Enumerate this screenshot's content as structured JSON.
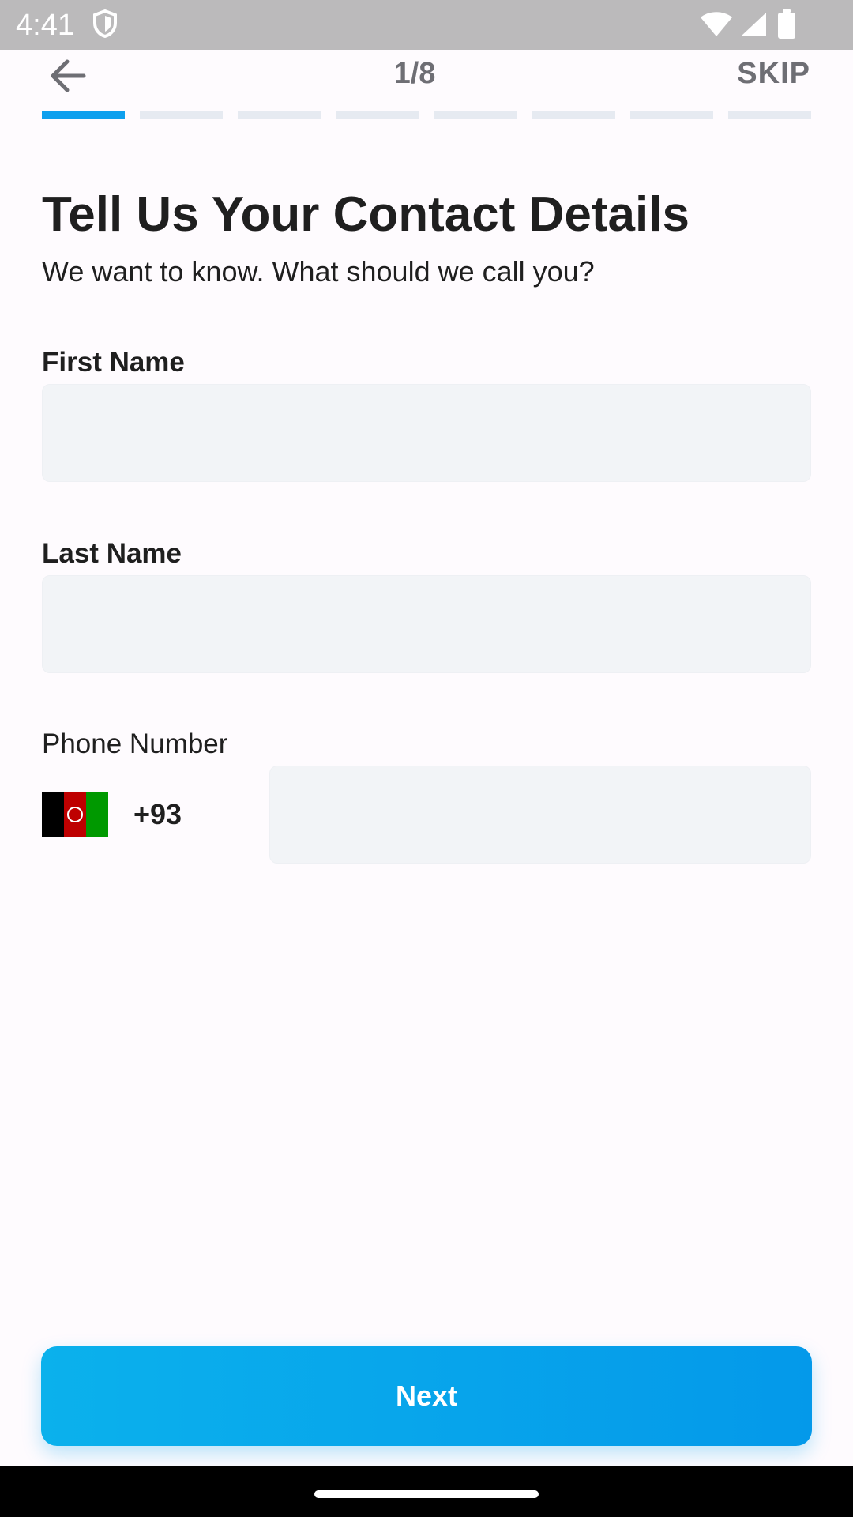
{
  "status_bar": {
    "time": "4:41",
    "icons": [
      "shield-icon",
      "wifi-icon",
      "signal-icon",
      "battery-icon"
    ]
  },
  "header": {
    "back_icon": "arrow-left-icon",
    "step": "1/8",
    "skip_label": "SKIP",
    "progress": {
      "current": 1,
      "total": 8
    }
  },
  "content": {
    "title": "Tell Us Your Contact Details",
    "subtitle": "We want to know. What should we call you?"
  },
  "form": {
    "first_name": {
      "label": "First Name",
      "value": ""
    },
    "last_name": {
      "label": "Last Name",
      "value": ""
    },
    "phone": {
      "label": "Phone Number",
      "country_flag": "afghanistan-flag-icon",
      "dial_code": "+93",
      "value": ""
    }
  },
  "actions": {
    "next_label": "Next"
  },
  "colors": {
    "accent": "#0EA0EE",
    "background": "#FEFBFE",
    "field_background": "#F2F4F7",
    "status_bar": "#BBBABB"
  }
}
